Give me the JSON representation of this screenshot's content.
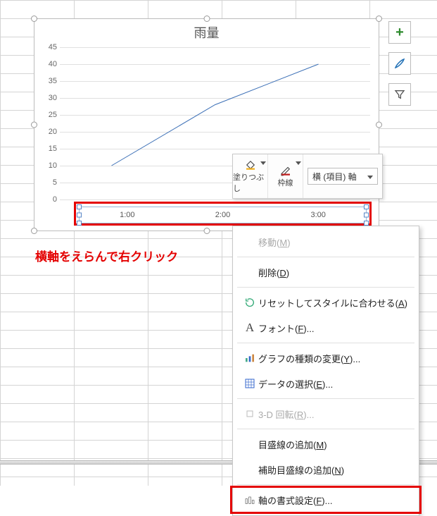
{
  "chart_data": {
    "type": "line",
    "title": "雨量",
    "categories": [
      "1:00",
      "2:00",
      "3:00"
    ],
    "values": [
      10,
      28,
      40
    ],
    "ylim": [
      0,
      45
    ],
    "y_ticks": [
      0,
      5,
      10,
      15,
      20,
      25,
      30,
      35,
      40,
      45
    ],
    "xlabel": "",
    "ylabel": ""
  },
  "annotation": {
    "instruction": "横軸をえらんで右クリック"
  },
  "mini_toolbar": {
    "fill_label": "塗りつぶし",
    "outline_label": "枠線",
    "selector_value": "横 (項目) 軸"
  },
  "side_buttons": {
    "add_element": "chart-elements",
    "styles": "chart-styles",
    "filter": "chart-filter"
  },
  "context_menu": {
    "items": [
      {
        "label": "移動",
        "accel": "M",
        "disabled": true,
        "icon": ""
      },
      {
        "label": "削除",
        "accel": "D",
        "disabled": false,
        "icon": ""
      },
      {
        "label": "リセットしてスタイルに合わせる",
        "accel": "A",
        "disabled": false,
        "icon": "reset"
      },
      {
        "label": "フォント",
        "accel": "F",
        "suffix": "...",
        "disabled": false,
        "icon": "font"
      },
      {
        "label": "グラフの種類の変更",
        "accel": "Y",
        "suffix": "...",
        "disabled": false,
        "icon": "chart-type"
      },
      {
        "label": "データの選択",
        "accel": "E",
        "suffix": "...",
        "disabled": false,
        "icon": "select-data"
      },
      {
        "label": "3-D 回転",
        "accel": "R",
        "suffix": "...",
        "disabled": true,
        "icon": "rotate-3d"
      },
      {
        "label": "目盛線の追加",
        "accel": "M",
        "disabled": false,
        "icon": ""
      },
      {
        "label": "補助目盛線の追加",
        "accel": "N",
        "disabled": false,
        "icon": ""
      },
      {
        "label": "軸の書式設定",
        "accel": "F",
        "suffix": "...",
        "disabled": false,
        "icon": "format-axis",
        "highlight": true
      }
    ]
  }
}
